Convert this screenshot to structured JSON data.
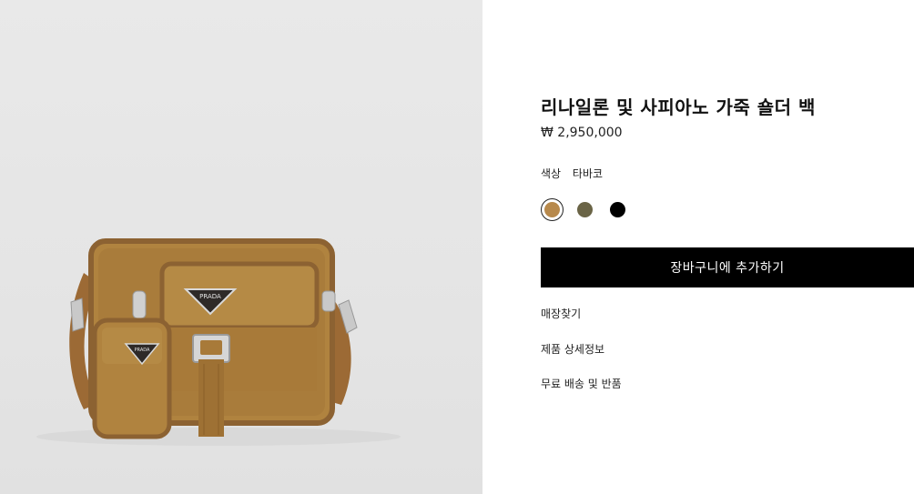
{
  "product": {
    "title": "리나일론 및 사피아노 가죽 숄더 백",
    "price": "₩ 2,950,000",
    "color_label": "색상",
    "color_value": "타바코",
    "swatches": [
      {
        "name": "타바코",
        "color": "#b7894c",
        "selected": true
      },
      {
        "name": "olive",
        "color": "#6a6446",
        "selected": false
      },
      {
        "name": "black",
        "color": "#000000",
        "selected": false
      }
    ]
  },
  "actions": {
    "add_to_cart": "장바구니에 추가하기"
  },
  "links": {
    "store_finder": "매장찾기",
    "product_details": "제품 상세정보",
    "shipping_returns": "무료 배송 및 반품"
  },
  "image": {
    "logo_text": "PRADA",
    "bag_color": "#b0833f",
    "trim_color": "#8c6232"
  }
}
